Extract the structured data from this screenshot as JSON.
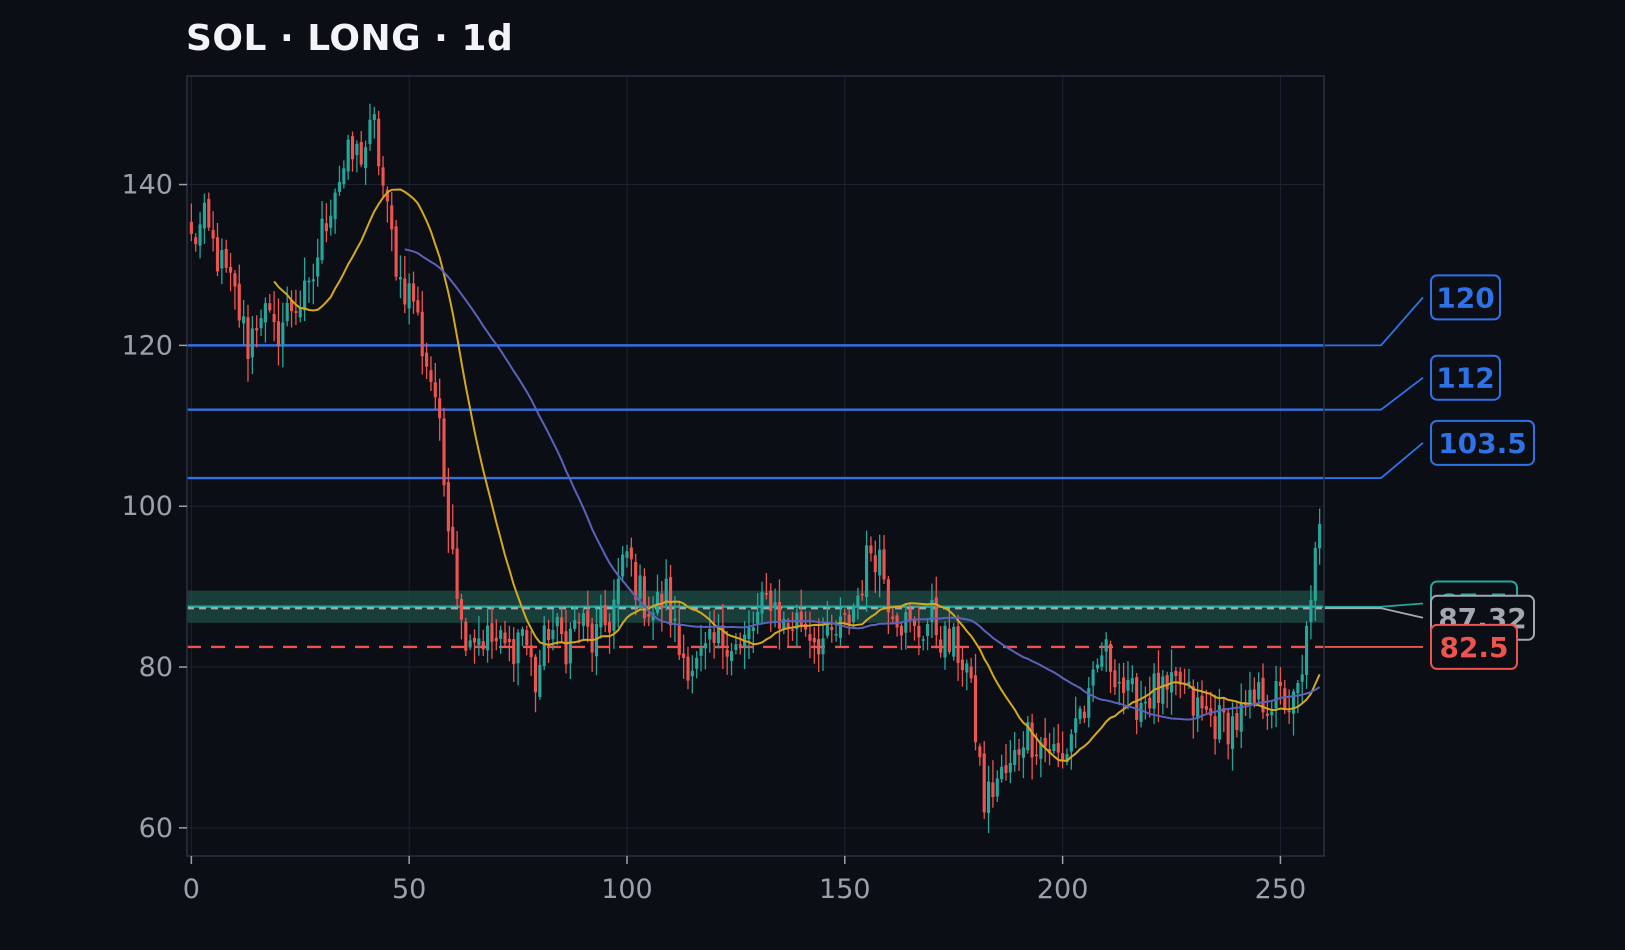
{
  "header": {
    "title": "SOL · LONG · 1d"
  },
  "colors": {
    "background": "#0b0e15",
    "up": "#26a69a",
    "down": "#ef5350",
    "ma_fast": "#d4a91f",
    "ma_slow": "#5b62b8",
    "level_blue": "#2f72e6",
    "level_entry": "#26a69a",
    "level_current": "#a3a8b0",
    "level_stop": "#ef5350",
    "zone": "#1f4d45",
    "grid": "#1c2230"
  },
  "chart_data": {
    "type": "candlestick",
    "title": "SOL · LONG · 1d",
    "xlim": [
      -1,
      260
    ],
    "ylim": [
      56.5,
      153.5
    ],
    "xticks": [
      0,
      50,
      100,
      150,
      200,
      250
    ],
    "yticks": [
      60,
      80,
      100,
      120,
      140
    ],
    "grid": true,
    "candle_anchors": [
      [
        0,
        133
      ],
      [
        3,
        135
      ],
      [
        6,
        131
      ],
      [
        10,
        126
      ],
      [
        13,
        120
      ],
      [
        16,
        125
      ],
      [
        19,
        121
      ],
      [
        23,
        125
      ],
      [
        27,
        126
      ],
      [
        30,
        134
      ],
      [
        33,
        140
      ],
      [
        36,
        143
      ],
      [
        39,
        144
      ],
      [
        42,
        147
      ],
      [
        45,
        136
      ],
      [
        48,
        128
      ],
      [
        51,
        126
      ],
      [
        53,
        120
      ],
      [
        56,
        114
      ],
      [
        58,
        103
      ],
      [
        60,
        96
      ],
      [
        62,
        85
      ],
      [
        66,
        84
      ],
      [
        70,
        83
      ],
      [
        73,
        82
      ],
      [
        76,
        85
      ],
      [
        79,
        78
      ],
      [
        82,
        85
      ],
      [
        86,
        83
      ],
      [
        89,
        86
      ],
      [
        92,
        83
      ],
      [
        96,
        86
      ],
      [
        98,
        90
      ],
      [
        100,
        94
      ],
      [
        103,
        89
      ],
      [
        106,
        87
      ],
      [
        109,
        89
      ],
      [
        112,
        82
      ],
      [
        116,
        80
      ],
      [
        119,
        82
      ],
      [
        123,
        84
      ],
      [
        126,
        82
      ],
      [
        130,
        86
      ],
      [
        133,
        89
      ],
      [
        136,
        85
      ],
      [
        140,
        86
      ],
      [
        143,
        84
      ],
      [
        146,
        83
      ],
      [
        150,
        85
      ],
      [
        153,
        89
      ],
      [
        156,
        95
      ],
      [
        158,
        94
      ],
      [
        160,
        89
      ],
      [
        163,
        86
      ],
      [
        166,
        84
      ],
      [
        170,
        86
      ],
      [
        173,
        83
      ],
      [
        176,
        82
      ],
      [
        178,
        80
      ],
      [
        180,
        72
      ],
      [
        182,
        63
      ],
      [
        185,
        66
      ],
      [
        188,
        67
      ],
      [
        191,
        72
      ],
      [
        194,
        71
      ],
      [
        197,
        70
      ],
      [
        200,
        68
      ],
      [
        203,
        74
      ],
      [
        206,
        75
      ],
      [
        209,
        82
      ],
      [
        212,
        80
      ],
      [
        215,
        76
      ],
      [
        218,
        76
      ],
      [
        221,
        77
      ],
      [
        224,
        76
      ],
      [
        227,
        78
      ],
      [
        230,
        75
      ],
      [
        233,
        74
      ],
      [
        236,
        73
      ],
      [
        239,
        73
      ],
      [
        242,
        74
      ],
      [
        245,
        76
      ],
      [
        248,
        76
      ],
      [
        251,
        76
      ],
      [
        253,
        75
      ],
      [
        255,
        78
      ],
      [
        257,
        90
      ],
      [
        259,
        96
      ]
    ],
    "moving_averages": [
      {
        "name": "",
        "color": "#d4a91f",
        "period": 20
      },
      {
        "name": "",
        "color": "#5b62b8",
        "period": 50
      }
    ],
    "levels": [
      {
        "label": "120",
        "value": 120,
        "color": "#2f72e6",
        "style": "solid",
        "label_offset": 30
      },
      {
        "label": "112",
        "value": 112,
        "color": "#2f72e6",
        "style": "solid",
        "label_offset": 20
      },
      {
        "label": "103.5",
        "value": 103.5,
        "color": "#2f72e6",
        "style": "solid",
        "label_offset": 22
      },
      {
        "label": "87.5",
        "value": 87.5,
        "color": "#26a69a",
        "style": "solid",
        "label_offset": 2
      },
      {
        "label": "87.32",
        "value": 87.32,
        "color": "#a3a8b0",
        "style": "dashed",
        "label_offset": -6
      },
      {
        "label": "82.5",
        "value": 82.5,
        "color": "#ef5350",
        "style": "dashed",
        "label_offset": 0
      }
    ],
    "zone": {
      "low": 85.5,
      "high": 89.5,
      "color": "#1f4d45"
    },
    "current_price": 87.32
  }
}
